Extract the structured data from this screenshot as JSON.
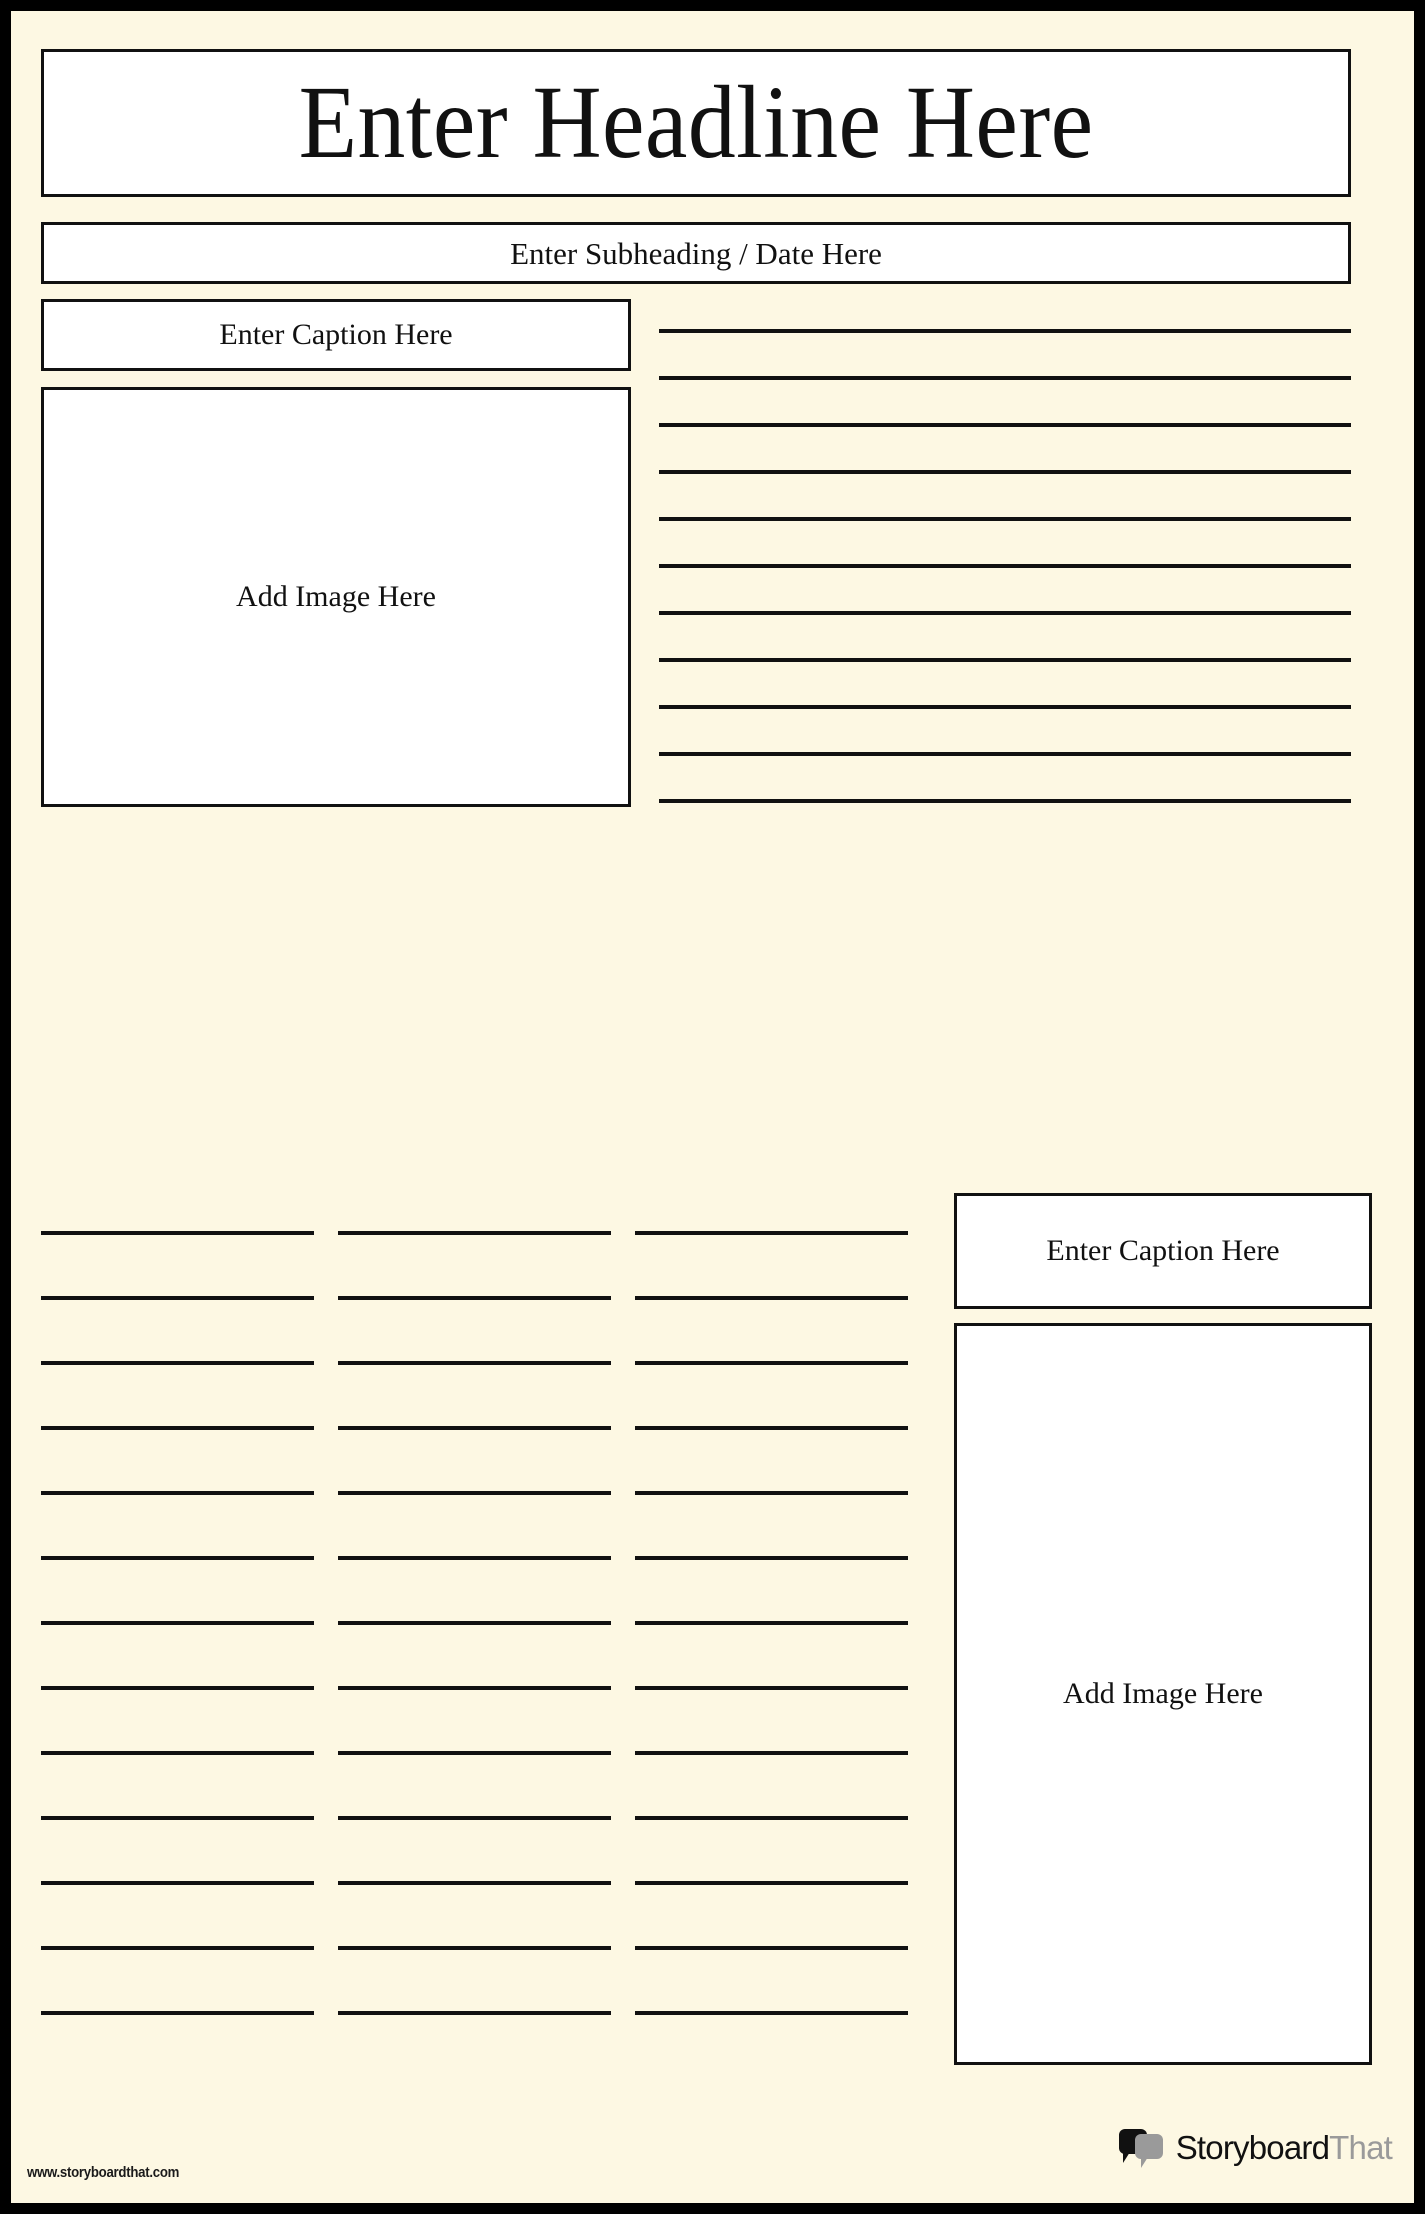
{
  "template": {
    "kind": "newspaper-article-worksheet",
    "colors": {
      "frame": "#000000",
      "paper": "#fdf8e3",
      "field_fill": "#ffffff",
      "rule": "#111111",
      "brand_primary": "#111111",
      "brand_secondary": "#9a9a9a"
    }
  },
  "headline": {
    "placeholder": "Enter Headline Here"
  },
  "subheading": {
    "placeholder": "Enter Subheading / Date Here"
  },
  "article_top": {
    "caption": {
      "placeholder": "Enter Caption Here"
    },
    "image": {
      "placeholder": "Add Image Here"
    },
    "writing_lines": {
      "count": 11
    }
  },
  "article_bottom": {
    "columns": [
      {
        "name": "column-1",
        "writing_lines": {
          "count": 13
        }
      },
      {
        "name": "column-2",
        "writing_lines": {
          "count": 13
        }
      },
      {
        "name": "column-3",
        "writing_lines": {
          "count": 13
        }
      }
    ],
    "caption": {
      "placeholder": "Enter Caption Here"
    },
    "image": {
      "placeholder": "Add Image Here"
    }
  },
  "footer": {
    "url": "www.storyboardthat.com",
    "brand": {
      "word_primary": "Storyboard",
      "word_secondary": "That",
      "mark": "speech-bubbles-icon"
    }
  }
}
